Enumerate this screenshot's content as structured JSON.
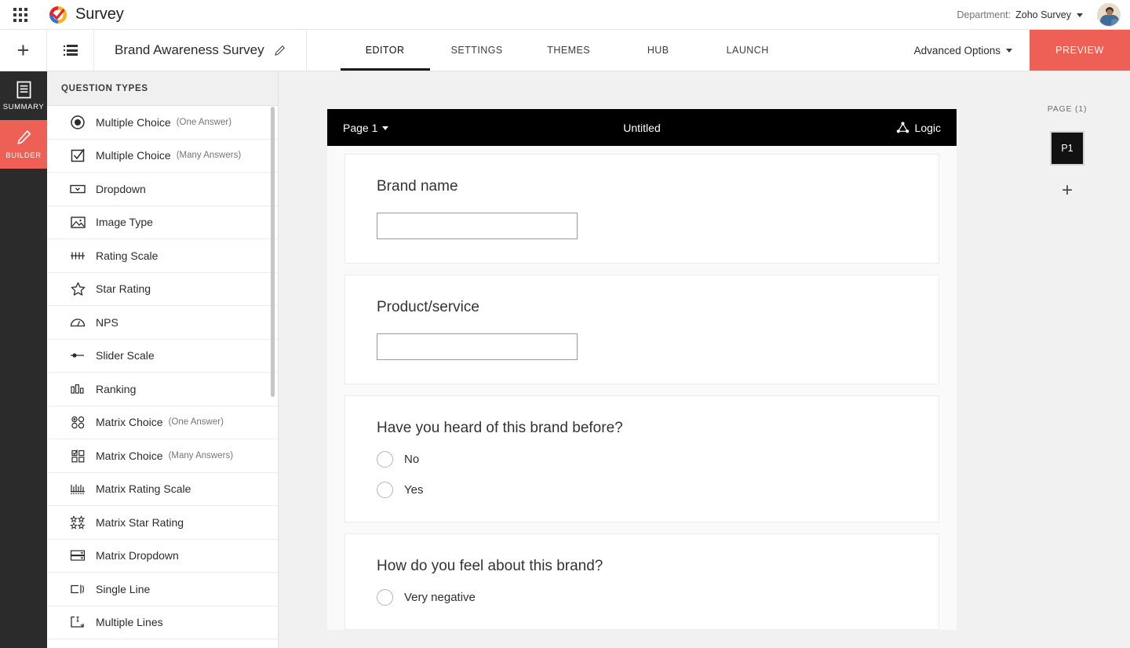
{
  "topbar": {
    "apps_icon": "apps-grid-icon",
    "logo_icon": "zoho-survey-logo-icon",
    "product_name": "Survey",
    "department_label": "Department:",
    "department_value": "Zoho Survey",
    "department_caret_icon": "chevron-down-icon",
    "avatar_icon": "user-avatar"
  },
  "toolbar": {
    "add_icon": "plus-icon",
    "list_icon": "list-view-icon",
    "survey_title": "Brand Awareness Survey",
    "edit_icon": "pencil-icon",
    "tabs": [
      {
        "label": "EDITOR",
        "active": true
      },
      {
        "label": "SETTINGS",
        "active": false
      },
      {
        "label": "THEMES",
        "active": false
      },
      {
        "label": "HUB",
        "active": false
      },
      {
        "label": "LAUNCH",
        "active": false
      }
    ],
    "advanced_options": "Advanced Options",
    "advanced_caret_icon": "chevron-down-icon",
    "preview_label": "PREVIEW",
    "preview_color": "#ee5f56"
  },
  "rail": {
    "items": [
      {
        "label": "SUMMARY",
        "icon": "document-icon",
        "active": false
      },
      {
        "label": "BUILDER",
        "icon": "pencil-icon",
        "active": true
      }
    ],
    "active_color": "#ee5f56",
    "background_color": "#2b2b2b"
  },
  "question_panel": {
    "header": "QUESTION TYPES",
    "items": [
      {
        "label": "Multiple Choice",
        "sub": "(One Answer)",
        "icon": "radio-filled-icon"
      },
      {
        "label": "Multiple Choice",
        "sub": "(Many Answers)",
        "icon": "checkbox-checked-icon"
      },
      {
        "label": "Dropdown",
        "sub": "",
        "icon": "dropdown-icon"
      },
      {
        "label": "Image Type",
        "sub": "",
        "icon": "image-icon"
      },
      {
        "label": "Rating Scale",
        "sub": "",
        "icon": "rating-scale-icon"
      },
      {
        "label": "Star Rating",
        "sub": "",
        "icon": "star-icon"
      },
      {
        "label": "NPS",
        "sub": "",
        "icon": "gauge-icon"
      },
      {
        "label": "Slider Scale",
        "sub": "",
        "icon": "slider-icon"
      },
      {
        "label": "Ranking",
        "sub": "",
        "icon": "bars-icon"
      },
      {
        "label": "Matrix Choice",
        "sub": "(One Answer)",
        "icon": "matrix-radio-icon"
      },
      {
        "label": "Matrix Choice",
        "sub": "(Many Answers)",
        "icon": "matrix-checkbox-icon"
      },
      {
        "label": "Matrix Rating Scale",
        "sub": "",
        "icon": "matrix-rating-icon"
      },
      {
        "label": "Matrix Star Rating",
        "sub": "",
        "icon": "matrix-star-icon"
      },
      {
        "label": "Matrix Dropdown",
        "sub": "",
        "icon": "matrix-dropdown-icon"
      },
      {
        "label": "Single Line",
        "sub": "",
        "icon": "single-line-icon"
      },
      {
        "label": "Multiple Lines",
        "sub": "",
        "icon": "multi-line-icon"
      }
    ]
  },
  "survey": {
    "page_selector": "Page 1",
    "page_caret_icon": "chevron-down-icon",
    "title": "Untitled",
    "logic_label": "Logic",
    "logic_icon": "logic-triangle-icon",
    "questions": [
      {
        "title": "Brand name",
        "type": "text",
        "input_value": "",
        "input_placeholder": "",
        "options": []
      },
      {
        "title": "Product/service",
        "type": "text",
        "input_value": "",
        "input_placeholder": "",
        "options": []
      },
      {
        "title": "Have you heard of this brand before?",
        "type": "radio",
        "options": [
          "No",
          "Yes"
        ]
      },
      {
        "title": "How do you feel about this brand?",
        "type": "radio",
        "options": [
          "Very negative"
        ]
      }
    ]
  },
  "page_strip": {
    "count_label": "PAGE (1)",
    "pages": [
      {
        "label": "P1",
        "active": true
      }
    ],
    "add_icon": "plus-icon"
  }
}
